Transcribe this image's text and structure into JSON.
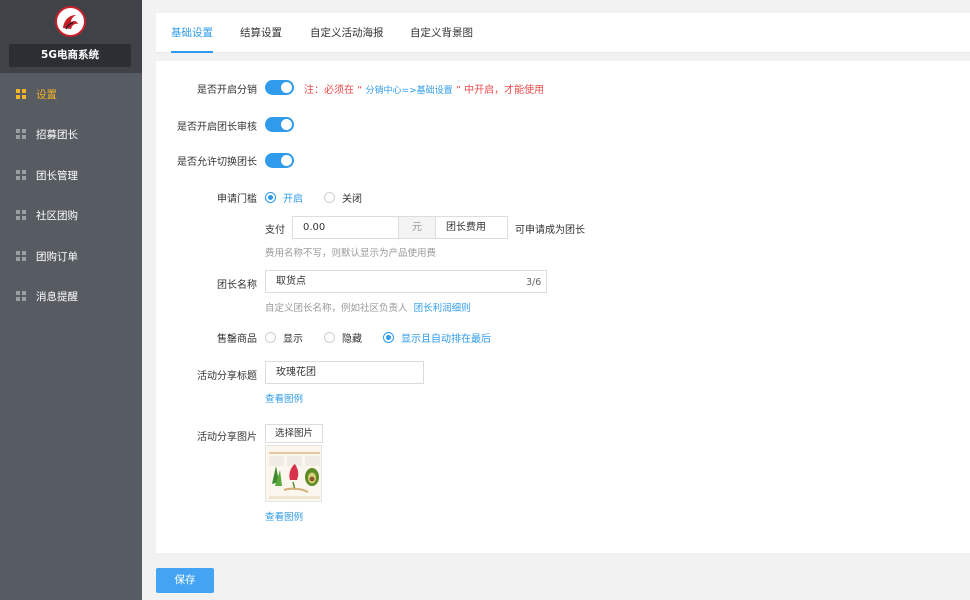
{
  "app": {
    "name": "5G电商系统"
  },
  "sidebar": {
    "items": [
      {
        "label": "设置",
        "active": true
      },
      {
        "label": "招募团长"
      },
      {
        "label": "团长管理"
      },
      {
        "label": "社区团购"
      },
      {
        "label": "团购订单"
      },
      {
        "label": "消息提醒"
      }
    ]
  },
  "tabs": [
    {
      "label": "基础设置",
      "active": true
    },
    {
      "label": "结算设置"
    },
    {
      "label": "自定义活动海报"
    },
    {
      "label": "自定义背景图"
    }
  ],
  "form": {
    "distribution": {
      "label": "是否开启分销",
      "enabled": true,
      "note_prefix": "注：必须在 “ ",
      "note_highlight": "分销中心=>基础设置",
      "note_suffix": " ” 中开启，才能使用"
    },
    "leader_review": {
      "label": "是否开启团长审核",
      "enabled": true
    },
    "switch_leader": {
      "label": "是否允许切换团长",
      "enabled": true
    },
    "threshold": {
      "label": "申请门槛",
      "options": [
        "开启",
        "关闭"
      ],
      "selected": "开启",
      "pay_label": "支付",
      "amount": "0.00",
      "unit": "元",
      "fee_name": "团长费用",
      "suffix": "可申请成为团长",
      "hint": "费用名称不写，则默认显示为产品使用费"
    },
    "leader_name": {
      "label": "团长名称",
      "value": "取货点",
      "counter": "3/6",
      "hint": "自定义团长名称，例如社区负责人",
      "hint_link": "团长利润细则"
    },
    "soldout": {
      "label": "售罄商品",
      "options": [
        "显示",
        "隐藏",
        "显示且自动排在最后"
      ],
      "selected": "显示且自动排在最后"
    },
    "share_title": {
      "label": "活动分享标题",
      "value": "玫瑰花团",
      "example_link": "查看图例"
    },
    "share_image": {
      "label": "活动分享图片",
      "button": "选择图片",
      "example_link": "查看图例"
    }
  },
  "actions": {
    "save": "保存"
  },
  "colors": {
    "accent": "#2f9bea",
    "sidebar": "#575b62",
    "active_nav": "#f2b527",
    "warning": "#e94b4b"
  }
}
